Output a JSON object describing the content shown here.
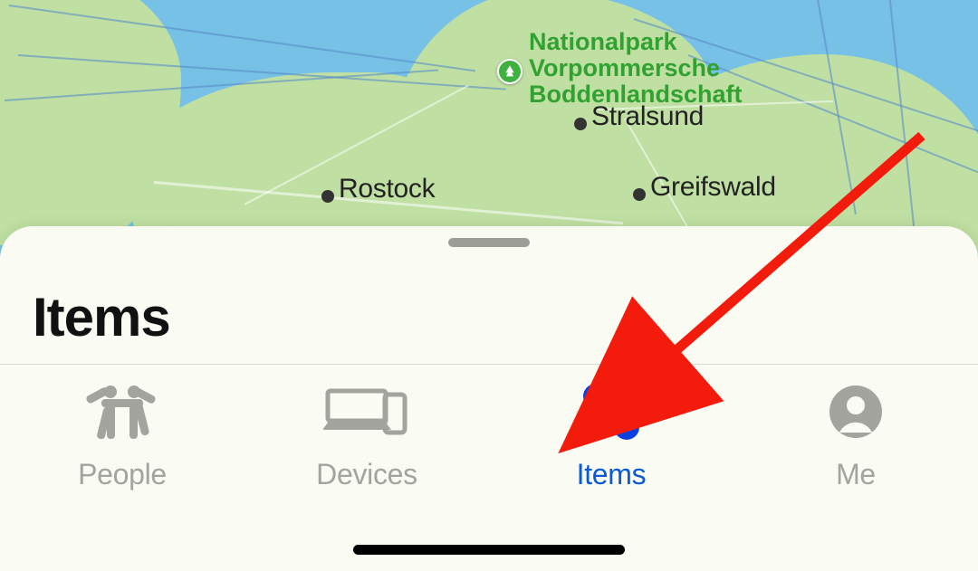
{
  "sheet": {
    "title": "Items"
  },
  "tabs": {
    "people": {
      "label": "People"
    },
    "devices": {
      "label": "Devices"
    },
    "items": {
      "label": "Items"
    },
    "me": {
      "label": "Me"
    }
  },
  "map": {
    "park_label_1": "Nationalpark",
    "park_label_2": "Vorpommersche",
    "park_label_3": "Boddenlandschaft",
    "cities": {
      "rostock": "Rostock",
      "stralsund": "Stralsund",
      "greifswald": "Greifswald"
    }
  }
}
